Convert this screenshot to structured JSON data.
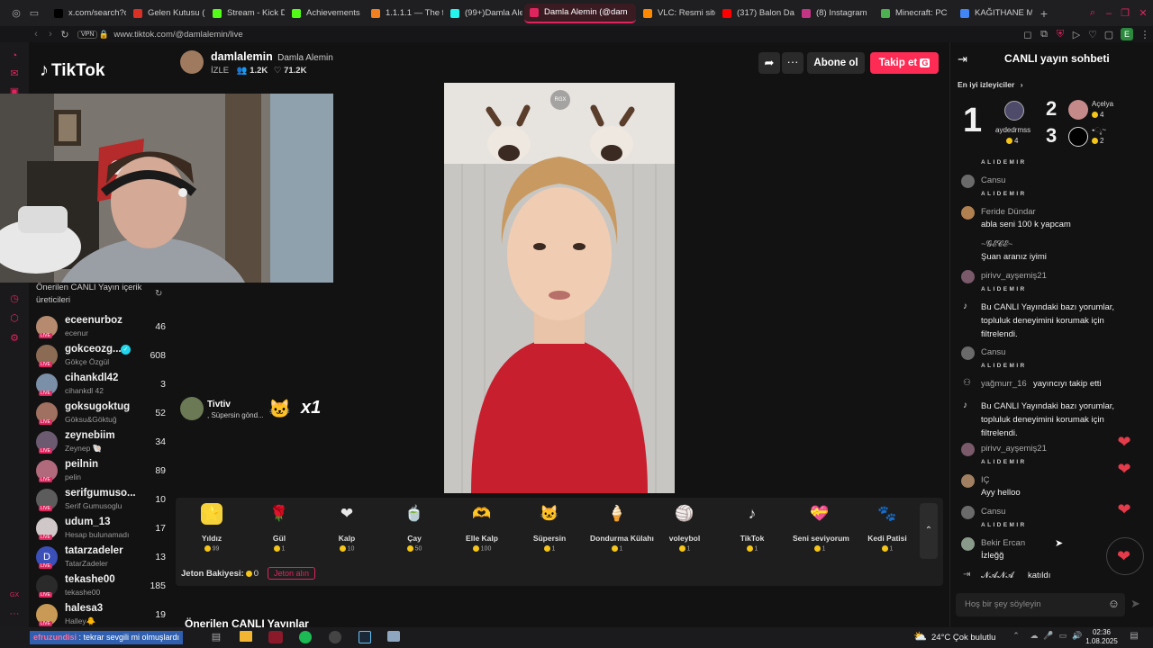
{
  "browser": {
    "tabs": [
      {
        "label": "x.com/search?q",
        "color": "#000000",
        "icon": "x-logo-icon"
      },
      {
        "label": "Gelen Kutusu (",
        "color": "#d93025",
        "icon": "gmail-icon"
      },
      {
        "label": "Stream - Kick D",
        "color": "#53fc18",
        "icon": "kick-icon"
      },
      {
        "label": "Achievements",
        "color": "#53fc18",
        "icon": "kick-icon"
      },
      {
        "label": "1.1.1.1 — The fr",
        "color": "#f38020",
        "icon": "cloudflare-icon"
      },
      {
        "label": "(99+)Damla Ale",
        "color": "#25f4ee",
        "icon": "tiktok-icon"
      },
      {
        "label": "Damla Alemin (@dam",
        "color": "#e0245e",
        "icon": "tiktok-icon"
      },
      {
        "label": "VLC: Resmi site",
        "color": "#ff8800",
        "icon": "vlc-icon"
      },
      {
        "label": "(317) Balon Dal",
        "color": "#ff0000",
        "icon": "youtube-icon"
      },
      {
        "label": "(8) Instagram",
        "color": "#c13584",
        "icon": "instagram-icon"
      },
      {
        "label": "Minecraft: PC",
        "color": "#4caf50",
        "icon": "minecraft-icon"
      },
      {
        "label": "KAĞITHANE M",
        "color": "#4285f4",
        "icon": "google-icon"
      }
    ],
    "active_tab": 6,
    "vpn": "VPN",
    "url": "www.tiktok.com/@damlalemin/live",
    "profile_letter": "E"
  },
  "webcam": {
    "label": "streamer webcam"
  },
  "sidebar": {
    "logo": "TikTok",
    "suggested_title": "Önerilen CANLI Yayın içerik üreticileri",
    "suggested": [
      {
        "name": "eceenurboz",
        "sub": "ecenur",
        "count": "46",
        "color": "#b58a6e"
      },
      {
        "name": "gokceozg...",
        "sub": "Gökçe Özgül",
        "count": "608",
        "color": "#8c6b55"
      },
      {
        "name": "cihankdl42",
        "sub": "cihankdl 42",
        "count": "3",
        "color": "#7a8fa8"
      },
      {
        "name": "goksugoktug",
        "sub": "Göksu&Göktuğ",
        "count": "52",
        "color": "#a07060"
      },
      {
        "name": "zeynebiim",
        "sub": "Zeynep 🐚",
        "count": "34",
        "color": "#6b5a70"
      },
      {
        "name": "peilnin",
        "sub": "pelin",
        "count": "89",
        "color": "#b06a7c"
      },
      {
        "name": "serifgumuso...",
        "sub": "Serif Gumusoglu",
        "count": "10",
        "color": "#5c5c5c"
      },
      {
        "name": "udum_13",
        "sub": "Hesap bulunamadı",
        "count": "17",
        "color": "#d0c8c8"
      },
      {
        "name": "tatarzadeler",
        "sub": "TatarZadeler",
        "count": "13",
        "color": "#3b4fb8"
      },
      {
        "name": "tekashe00",
        "sub": "tekashe00",
        "count": "185",
        "color": "#2a2a2a"
      },
      {
        "name": "halesa3",
        "sub": "Halley🐥",
        "count": "19",
        "color": "#c99a55"
      }
    ],
    "avatar_letter_tatar": "D",
    "live_tag": "LIVE",
    "bottom_label": "GX",
    "more_label": "···"
  },
  "header": {
    "username": "damlalemin",
    "display_name": "Damla Alemin",
    "izle": "İZLE",
    "viewers": "1.2K",
    "likes": "71.2K",
    "unfollow": "Abone ol",
    "follow": "Takip et",
    "follow_key": "G"
  },
  "video": {
    "watermark": "RGX"
  },
  "gift_notice": {
    "user": "Tivtiv",
    "text": ", Süpersin gönd...",
    "multiplier": "x1"
  },
  "gifts": [
    {
      "name": "Yıldız",
      "price": "99",
      "icon": "⭐",
      "bg": "#f5d13a"
    },
    {
      "name": "Gül",
      "price": "1",
      "icon": "🌹",
      "bg": "transparent"
    },
    {
      "name": "Kalp",
      "price": "10",
      "icon": "❤",
      "bg": "transparent"
    },
    {
      "name": "Çay",
      "price": "50",
      "icon": "🍵",
      "bg": "transparent"
    },
    {
      "name": "Elle Kalp",
      "price": "100",
      "icon": "🫶",
      "bg": "transparent"
    },
    {
      "name": "Süpersin",
      "price": "1",
      "icon": "🐱",
      "bg": "transparent"
    },
    {
      "name": "Dondurma Külahı",
      "price": "1",
      "icon": "🍦",
      "bg": "transparent"
    },
    {
      "name": "voleybol",
      "price": "1",
      "icon": "🏐",
      "bg": "transparent"
    },
    {
      "name": "TikTok",
      "price": "1",
      "icon": "♪",
      "bg": "transparent"
    },
    {
      "name": "Seni seviyorum",
      "price": "1",
      "icon": "💝",
      "bg": "transparent"
    },
    {
      "name": "Kedi Patisi",
      "price": "1",
      "icon": "🐾",
      "bg": "transparent"
    }
  ],
  "balance": {
    "label": "Jeton Bakiyesi:",
    "value": "0",
    "button": "Jeton alın"
  },
  "below_title": "Önerilen CANLI Yayınlar",
  "chat": {
    "title": "CANLI yayın sohbeti",
    "top_viewers_label": "En iyi izleyiciler",
    "top": [
      {
        "rank": "1",
        "name": "aydedrmss",
        "coins": "4"
      },
      {
        "rank": "2",
        "name": "Açelya",
        "coins": "4"
      },
      {
        "rank": "3",
        "name": "⭑ೃ~",
        "coins": "2"
      }
    ],
    "messages": [
      {
        "type": "badge",
        "badge": "ALIDEMIR"
      },
      {
        "type": "msg",
        "name": "Cansu",
        "text": "",
        "badge": "ALIDEMIR",
        "color": "#6a6a6a"
      },
      {
        "type": "msg",
        "name": "Feride Dündar",
        "text": "abla seni 100 k yapcam",
        "badge": "",
        "color": "#b08050"
      },
      {
        "type": "msg",
        "name": "~𝓖𝓔𝓒𝓔~",
        "text": "Şuan aranız iyimi",
        "badge": "",
        "color": "#121212"
      },
      {
        "type": "msg",
        "name": "pirivv_ayşemiş21",
        "text": "",
        "badge": "ALIDEMIR",
        "color": "#7a5a6a"
      },
      {
        "type": "sys",
        "text": "Bu CANLI Yayındaki bazı yorumlar, topluluk deneyimini korumak için filtrelendi."
      },
      {
        "type": "msg",
        "name": "Cansu",
        "text": "",
        "badge": "ALIDEMIR",
        "color": "#6a6a6a"
      },
      {
        "type": "follow",
        "name": "yağmurr_16",
        "text": "yayıncıyı takip etti"
      },
      {
        "type": "sys",
        "text": "Bu CANLI Yayındaki bazı yorumlar, topluluk deneyimini korumak için filtrelendi."
      },
      {
        "type": "msg",
        "name": "pirivv_ayşemiş21",
        "text": "",
        "badge": "ALIDEMIR",
        "color": "#7a5a6a"
      },
      {
        "type": "msg",
        "name": "IÇ",
        "text": "Ayy helloo",
        "badge": "",
        "color": "#a08060"
      },
      {
        "type": "msg",
        "name": "Cansu",
        "text": "",
        "badge": "ALIDEMIR",
        "color": "#6a6a6a"
      },
      {
        "type": "msg",
        "name": "Bekir Ercan",
        "text": "İzleğğ",
        "badge": "",
        "color": "#8a9a8a"
      },
      {
        "type": "join",
        "name": "𝓝𝓐𝓝𝓐",
        "text": "katıldı"
      }
    ],
    "input_placeholder": "Hoş bir şey söyleyin"
  },
  "taskbar": {
    "overlay_user": "efruzundisi",
    "overlay_text": ": tekrar sevgili mi olmuşlardı",
    "weather": "24°C  Çok bulutlu",
    "time": "02:36",
    "date": "1.08.2025"
  }
}
